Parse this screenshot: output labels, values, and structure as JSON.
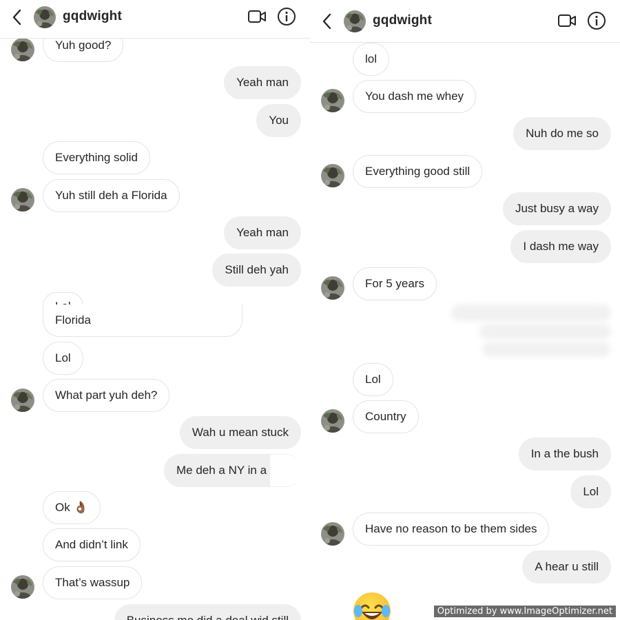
{
  "left": {
    "header": {
      "username": "gqdwight",
      "back_icon": "chevron-left-icon",
      "video_icon": "video-call-icon",
      "info_icon": "info-icon"
    },
    "messages": [
      {
        "text": "Yuh good?",
        "side": "in",
        "avatar": true
      },
      {
        "text": "Yeah man",
        "side": "out"
      },
      {
        "text": "You",
        "side": "out"
      },
      {
        "text": "Everything solid",
        "side": "in"
      },
      {
        "text": "Yuh still deh a Florida",
        "side": "in",
        "avatar": true
      },
      {
        "text": "Yeah man",
        "side": "out"
      },
      {
        "text": "Still deh yah",
        "side": "out"
      },
      {
        "text": "Lol",
        "side": "in"
      },
      {
        "text": "Florida",
        "side": "in"
      },
      {
        "text": "Lol",
        "side": "in"
      },
      {
        "text": "What part yuh deh?",
        "side": "in",
        "avatar": true
      },
      {
        "text": "Wah u mean stuck",
        "side": "out"
      },
      {
        "text": "Me deh a NY in a",
        "side": "out"
      },
      {
        "text": "Ok 👌🏾",
        "side": "in"
      },
      {
        "text": "And didn’t link",
        "side": "in"
      },
      {
        "text": "That’s wassup",
        "side": "in",
        "avatar": true
      },
      {
        "text": "Business me did a deal wid still",
        "side": "out"
      }
    ]
  },
  "right": {
    "header": {
      "username": "gqdwight",
      "back_icon": "chevron-left-icon",
      "video_icon": "video-call-icon",
      "info_icon": "info-icon"
    },
    "messages": [
      {
        "text": "lol",
        "side": "in"
      },
      {
        "text": "You dash me whey",
        "side": "in",
        "avatar": true
      },
      {
        "text": "Nuh do me so",
        "side": "out"
      },
      {
        "text": "Everything good still",
        "side": "in",
        "avatar": true
      },
      {
        "text": "Just busy a way",
        "side": "out"
      },
      {
        "text": "I dash me way",
        "side": "out"
      },
      {
        "text": "For 5 years",
        "side": "in",
        "avatar": true
      },
      {
        "text": "Lol",
        "side": "in"
      },
      {
        "text": "Country",
        "side": "in",
        "avatar": true
      },
      {
        "text": "In a the bush",
        "side": "out"
      },
      {
        "text": "Lol",
        "side": "out"
      },
      {
        "text": "Have no reason to be them sides",
        "side": "in",
        "avatar": true
      },
      {
        "text": "A hear u still",
        "side": "out"
      }
    ],
    "emoji": "face-with-tears-of-joy"
  },
  "watermark": "Optimized by www.ImageOptimizer.net"
}
